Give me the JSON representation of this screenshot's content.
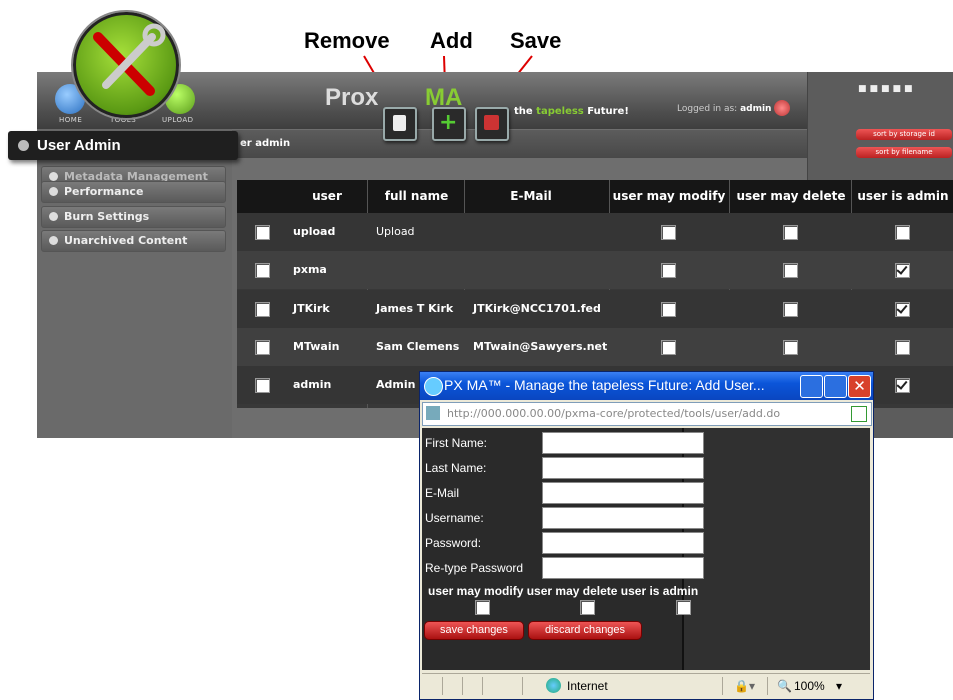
{
  "callouts": {
    "remove": "Remove",
    "add": "Add",
    "save": "Save"
  },
  "nav": {
    "home": "HOME",
    "tools": "TOOLS",
    "upload": "UPLOAD"
  },
  "header": {
    "logo": "Prox",
    "logo_ma": "MA",
    "tagline_a": "the",
    "tagline_b": "tapeless",
    "tagline_c": "Future!",
    "logged_label": "Logged in as:",
    "logged_user": "admin"
  },
  "subbar": {
    "text": "er admin"
  },
  "sidebar": {
    "active": "User Admin",
    "items": [
      "Metadata Management",
      "Performance",
      "Burn Settings",
      "Unarchived Content"
    ]
  },
  "right_panel": {
    "sort_storage": "sort by storage id",
    "sort_filename": "sort by filename"
  },
  "table": {
    "headers": [
      "user",
      "full name",
      "E-Mail",
      "user may modify",
      "user may delete",
      "user is admin"
    ],
    "rows": [
      {
        "user": "upload",
        "full_name": "Upload",
        "email": "",
        "modify": false,
        "delete": false,
        "admin": false
      },
      {
        "user": "pxma",
        "full_name": "",
        "email": "",
        "modify": false,
        "delete": false,
        "admin": true
      },
      {
        "user": "JTKirk",
        "full_name": "James T Kirk",
        "email": "JTKirk@NCC1701.fed",
        "modify": false,
        "delete": false,
        "admin": true
      },
      {
        "user": "MTwain",
        "full_name": "Sam Clemens",
        "email": "MTwain@Sawyers.net",
        "modify": false,
        "delete": false,
        "admin": false
      },
      {
        "user": "admin",
        "full_name": "Admin U",
        "email": "",
        "modify": false,
        "delete": false,
        "admin": true
      }
    ]
  },
  "popup": {
    "title": "PX MA™ - Manage the tapeless Future: Add User...",
    "url": "http://000.000.00.00/pxma-core/protected/tools/user/add.do",
    "fields": [
      "First Name:",
      "Last Name:",
      "E-Mail",
      "Username:",
      "Password:",
      "Re-type Password"
    ],
    "perm_labels": [
      "user may modify",
      "user may delete",
      "user is admin"
    ],
    "save_btn": "save changes",
    "discard_btn": "discard changes",
    "status_zone": "Internet",
    "zoom": "100%"
  },
  "colors": {
    "accent_green": "#7ab51d",
    "popup_blue": "#0b55d9",
    "red_button": "#c22"
  }
}
